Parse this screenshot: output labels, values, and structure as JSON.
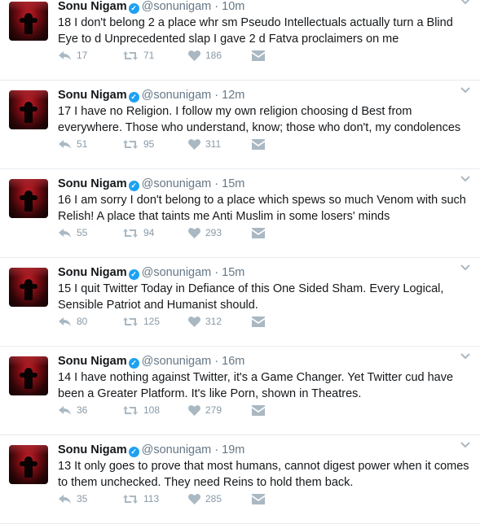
{
  "tweets": [
    {
      "name": "Sonu Nigam",
      "handle": "@sonunigam",
      "time": "· 10m",
      "text": "18 I don't belong 2 a place whr sm Pseudo Intellectuals actually turn a Blind Eye to d Unprecedented slap I gave 2 d Fatva proclaimers on me",
      "replies": "17",
      "retweets": "71",
      "likes": "186"
    },
    {
      "name": "Sonu Nigam",
      "handle": "@sonunigam",
      "time": "· 12m",
      "text": "17 I have no Religion. I follow my own religion choosing d Best from everywhere. Those who understand, know; those who don't, my condolences",
      "replies": "51",
      "retweets": "95",
      "likes": "311"
    },
    {
      "name": "Sonu Nigam",
      "handle": "@sonunigam",
      "time": "· 15m",
      "text": "16 I am sorry I don't belong to a place which spews so much Venom with such Relish! A place that taints me Anti Muslim in some losers' minds",
      "replies": "55",
      "retweets": "94",
      "likes": "293"
    },
    {
      "name": "Sonu Nigam",
      "handle": "@sonunigam",
      "time": "· 15m",
      "text": "15 I quit Twitter Today in Defiance of this One Sided Sham. Every Logical, Sensible Patriot and Humanist should.",
      "replies": "80",
      "retweets": "125",
      "likes": "312"
    },
    {
      "name": "Sonu Nigam",
      "handle": "@sonunigam",
      "time": "· 16m",
      "text": "14 I have nothing against Twitter, it's a Game Changer. Yet Twitter cud have been a Greater Platform. It's like Porn, shown in Theatres.",
      "replies": "36",
      "retweets": "108",
      "likes": "279"
    },
    {
      "name": "Sonu Nigam",
      "handle": "@sonunigam",
      "time": "· 19m",
      "text": "13 It only goes to prove that most humans, cannot digest power when it comes to them unchecked. They need Reins to hold them back.",
      "replies": "35",
      "retweets": "113",
      "likes": "285"
    }
  ],
  "icons": {
    "verified": "verified-badge-icon",
    "reply": "reply-arrow-icon",
    "retweet": "retweet-icon",
    "like": "heart-icon",
    "message": "envelope-icon",
    "caret": "chevron-down-icon"
  },
  "colors": {
    "verified": "#1da1f2",
    "muted": "#8899a6",
    "text": "#14171a",
    "divider": "#e6ecf0"
  }
}
